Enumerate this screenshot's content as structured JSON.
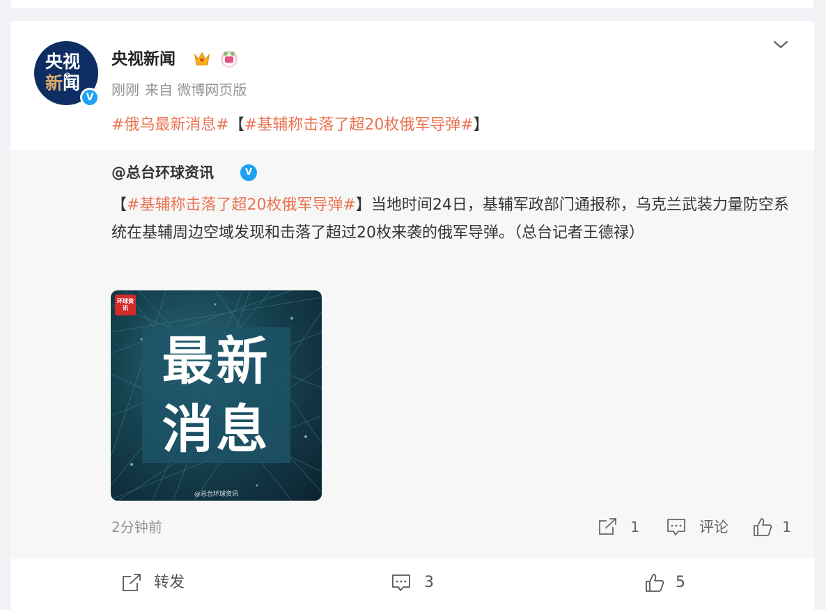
{
  "post": {
    "author": "央视新闻",
    "avatar_line1": "央视",
    "avatar_line2_a": "新",
    "avatar_line2_b": "闻",
    "avatar_at": "@",
    "verified_mark": "V",
    "time": "刚刚",
    "source": "来自 微博网页版",
    "text": {
      "topic1": "#俄乌最新消息#",
      "bracket_open": "【",
      "topic2": "#基辅称击落了超20枚俄军导弹#",
      "bracket_close": "】"
    }
  },
  "retweet": {
    "author": "@总台环球资讯",
    "verified_mark": "V",
    "text": {
      "bracket_open": "【",
      "topic": "#基辅称击落了超20枚俄军导弹#",
      "body": "】当地时间24日，基辅军政部门通报称，乌克兰武装力量防空系统在基辅周边空域发现和击落了超过20枚来袭的俄军导弹。（总台记者王德禄）"
    },
    "image": {
      "line1": "最新",
      "line2": "消息",
      "logo": "环球资讯",
      "watermark": "@总台环球资讯"
    },
    "time": "2分钟前",
    "actions": {
      "repost": "1",
      "comment": "评论",
      "like": "1"
    }
  },
  "actions": {
    "repost": "转发",
    "comment": "3",
    "like": "5"
  },
  "colors": {
    "accent": "#eb7350",
    "verified": "#1da1f2",
    "meta": "#939393"
  },
  "icons": [
    "crown-icon",
    "sticker-icon",
    "chevron-down-icon",
    "verified-icon",
    "repost-icon",
    "comment-icon",
    "like-icon"
  ]
}
